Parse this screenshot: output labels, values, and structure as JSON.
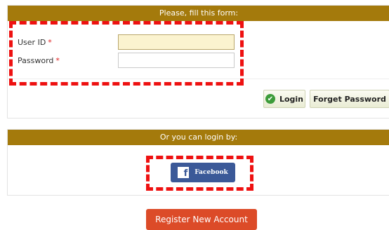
{
  "login_form": {
    "header": "Please, fill this form:",
    "user_id_label": "User ID",
    "password_label": "Password",
    "required_marker": "*",
    "user_id_value": "",
    "password_value": "",
    "login_label": "Login",
    "forget_label": "Forget Password"
  },
  "social_login": {
    "header": "Or you can login by:",
    "facebook_label": "Facebook"
  },
  "register": {
    "label": "Register New Account"
  },
  "colors": {
    "header_bg": "#a47a0c",
    "facebook": "#3b5998",
    "register": "#dc4b28",
    "highlight": "#ee1111"
  }
}
